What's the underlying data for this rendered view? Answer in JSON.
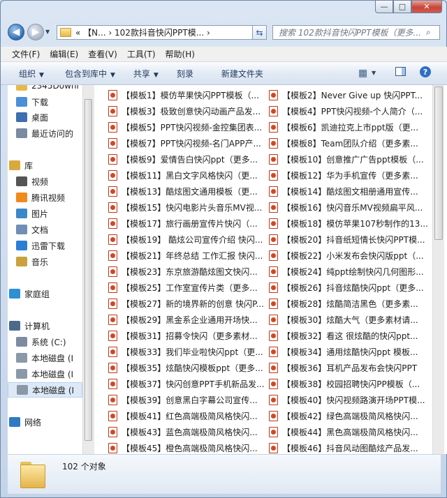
{
  "window": {
    "caption_min": "—",
    "caption_max": "□",
    "caption_close": "✕"
  },
  "address": {
    "path": "«  【N...  ›  102款抖音快闪PPT模...  ›",
    "refresh_glyph": "⇆",
    "search_placeholder": "搜索 102款抖音快闪PPT模板（更多..."
  },
  "menu": [
    "文件(F)",
    "编辑(E)",
    "查看(V)",
    "工具(T)",
    "帮助(H)"
  ],
  "toolbar": {
    "organize": "组织",
    "include": "包含到库中",
    "share": "共享",
    "burn": "刻录",
    "new_folder": "新建文件夹"
  },
  "sidebar": [
    {
      "label": "2345Downl",
      "icon": "folder-icon"
    },
    {
      "label": "下载",
      "icon": "download-folder-icon"
    },
    {
      "label": "桌面",
      "icon": "desktop-icon"
    },
    {
      "label": "最近访问的",
      "icon": "recent-icon"
    },
    {
      "label": "库",
      "icon": "library-icon"
    },
    {
      "label": "视频",
      "icon": "video-icon"
    },
    {
      "label": "腾讯视频",
      "icon": "tencent-video-icon"
    },
    {
      "label": "图片",
      "icon": "pictures-icon"
    },
    {
      "label": "文档",
      "icon": "documents-icon"
    },
    {
      "label": "迅雷下载",
      "icon": "thunder-icon"
    },
    {
      "label": "音乐",
      "icon": "music-icon"
    },
    {
      "label": "家庭组",
      "icon": "homegroup-icon"
    },
    {
      "label": "计算机",
      "icon": "computer-icon"
    },
    {
      "label": "系统 (C:)",
      "icon": "system-drive-icon"
    },
    {
      "label": "本地磁盘 (I",
      "icon": "drive-icon"
    },
    {
      "label": "本地磁盘 (I",
      "icon": "drive-icon"
    },
    {
      "label": "本地磁盘 (I",
      "icon": "drive-icon"
    },
    {
      "label": "网络",
      "icon": "network-icon"
    }
  ],
  "files": [
    "【模板1】模仿苹果快闪PPT模板（...",
    "【模板2】Never Give up 快闪PPT...",
    "【模板3】极致创意快闪动画产品发...",
    "【模板4】PPT快闪视频-个人简介（...",
    "【模板5】PPT快闪视频-金控集团表...",
    "【模板6】凯迪拉克上市ppt版（更...",
    "【模板7】PPT快闪视频-名门APP产...",
    "【模板8】Team团队介绍（更多素...",
    "【模板9】爱情告白快闪ppt（更多...",
    "【模板10】创意推广广告ppt模板（...",
    "【模板11】黑白文字风格快闪（更...",
    "【模板12】华为手机宣传（更多素...",
    "【模板13】酷炫图文通用模板（更...",
    "【模板14】酷炫图文相册通用宣传...",
    "【模板15】快闪电影片头音乐MV视...",
    "【模板16】快闪音乐MV视频扁平风...",
    "【模板17】旅行画册宣传片快闪（...",
    "【模板18】模仿苹果107秒制作的13...",
    "【模板19】 酷炫公司宣传介绍 快闪...",
    "【模板20】抖音纸短情长快闪PPT模...",
    "【模板21】年终总结 工作汇报 快闪...",
    "【模板22】小米发布会快闪版ppt（...",
    "【模板23】东京旅游酷炫图文快闪...",
    "【模板24】纯ppt绘制快闪几何图形...",
    "【模板25】工作室宣传片类（更多...",
    "【模板26】抖音炫酷快闪ppt（更多...",
    "【模板27】新的境界新的创意 快闪P...",
    "【模板28】炫酷简洁黑色（更多素...",
    "【模板29】黑金系企业通用开场快...",
    "【模板30】炫酷大气（更多素材请...",
    "【模板31】招募令快闪（更多素材...",
    "【模板32】看这 很炫酷的快闪ppt...",
    "【模板33】我们毕业啦快闪ppt（更...",
    "【模板34】通用炫酷快闪ppt 模板...",
    "【模板35】炫酷快闪模板ppt（更多...",
    "【模板36】耳机产品发布会快闪PPT",
    "【模板37】快闪创意PPT手机新品发...",
    "【模板38】校园招聘快闪PP模板（...",
    "【模板39】创意黑白字幕公司宣传...",
    "【模板40】快闪视频路演开场PPT模...",
    "【模板41】红色高端极简风格快闪...",
    "【模板42】绿色高端极简风格快闪...",
    "【模板43】蓝色高端极简风格快闪...",
    "【模板44】黑色高端极简风格快闪...",
    "【模板45】橙色高端极简风格快闪...",
    "【模板46】抖音风动图酷炫产品发..."
  ],
  "status": {
    "count": "102 个对象"
  }
}
